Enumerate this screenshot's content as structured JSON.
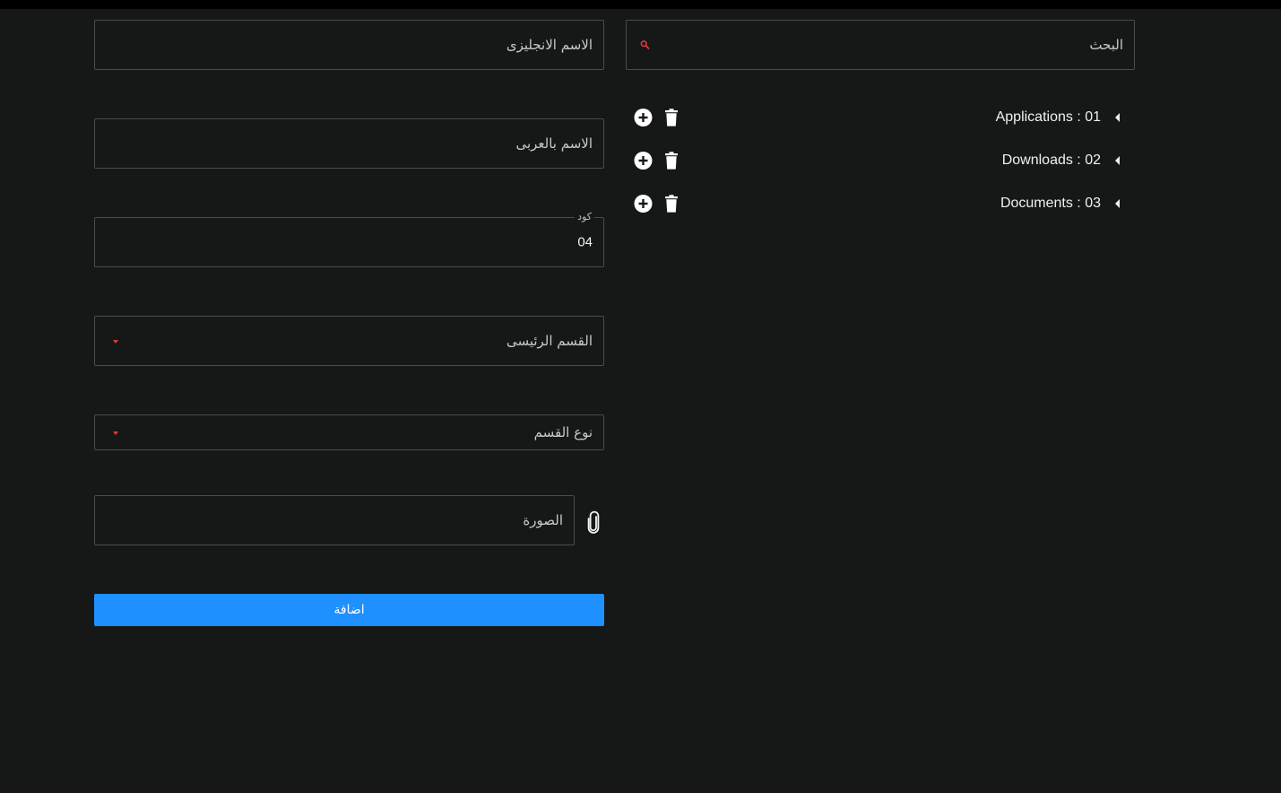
{
  "form": {
    "english_name_placeholder": "الاسم الانجليزى",
    "arabic_name_placeholder": "الاسم بالعربى",
    "code_label": "كود",
    "code_value": "04",
    "main_section_placeholder": "القسم الرئيسى",
    "section_type_placeholder": "نوع القسم",
    "image_placeholder": "الصورة",
    "submit_label": "اضافة"
  },
  "search": {
    "placeholder": "البحث"
  },
  "tree": [
    {
      "label": "Applications : 01"
    },
    {
      "label": "Downloads : 02"
    },
    {
      "label": "Documents : 03"
    }
  ],
  "colors": {
    "background": "#161818",
    "border": "#4a4c4c",
    "accent_blue": "#1e90ff",
    "accent_red": "#e53935"
  },
  "icons": [
    "search-icon",
    "chevron-down-icon",
    "paperclip-icon",
    "add-circle-icon",
    "trash-icon",
    "caret-left-icon"
  ]
}
